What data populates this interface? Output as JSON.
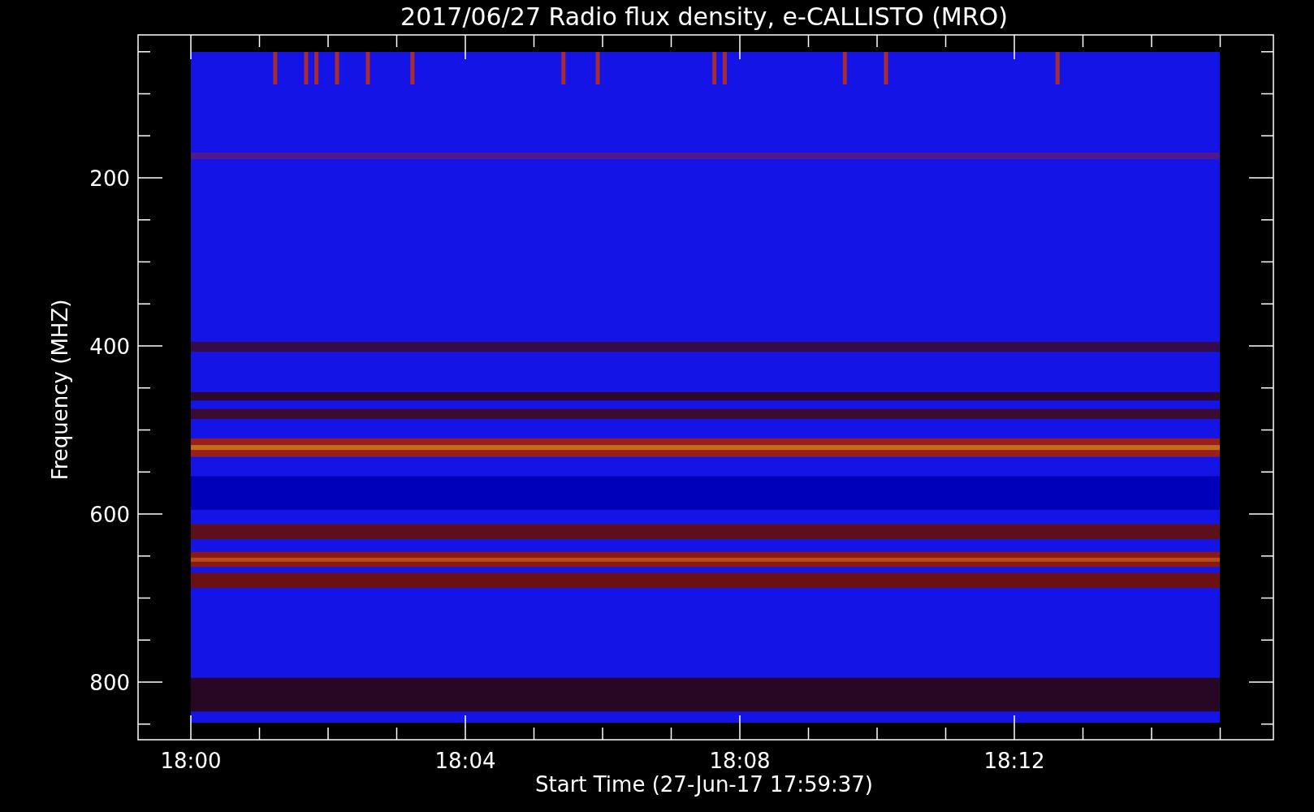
{
  "title": "2017/06/27  Radio flux density, e-CALLISTO (MRO)",
  "ylabel": "Frequency (MHZ)",
  "xlabel": "Start Time (27-Jun-17 17:59:37)",
  "yticks": [
    "200",
    "400",
    "600",
    "800"
  ],
  "xticks": [
    "18:00",
    "18:04",
    "18:08",
    "18:12"
  ]
}
